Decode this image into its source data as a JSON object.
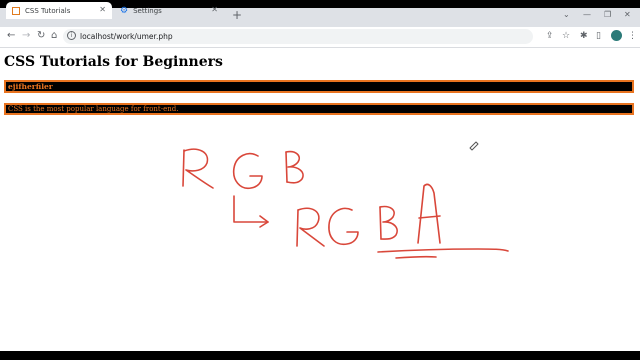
{
  "browser": {
    "tabs": [
      {
        "label": "CSS Tutorials",
        "active": true
      },
      {
        "label": "Settings",
        "active": false
      }
    ],
    "url": "localhost/work/umer.php"
  },
  "page": {
    "heading": "CSS Tutorials for Beginners",
    "box1_text": "ejifherfiler",
    "box2_text": "CSS is the most popular language for front-end.",
    "box_border_color": "#e8731f",
    "box_background": "#000000"
  },
  "annotation": {
    "ink_color": "#d9473a",
    "line1": "RGB",
    "line2": "RGBA"
  }
}
